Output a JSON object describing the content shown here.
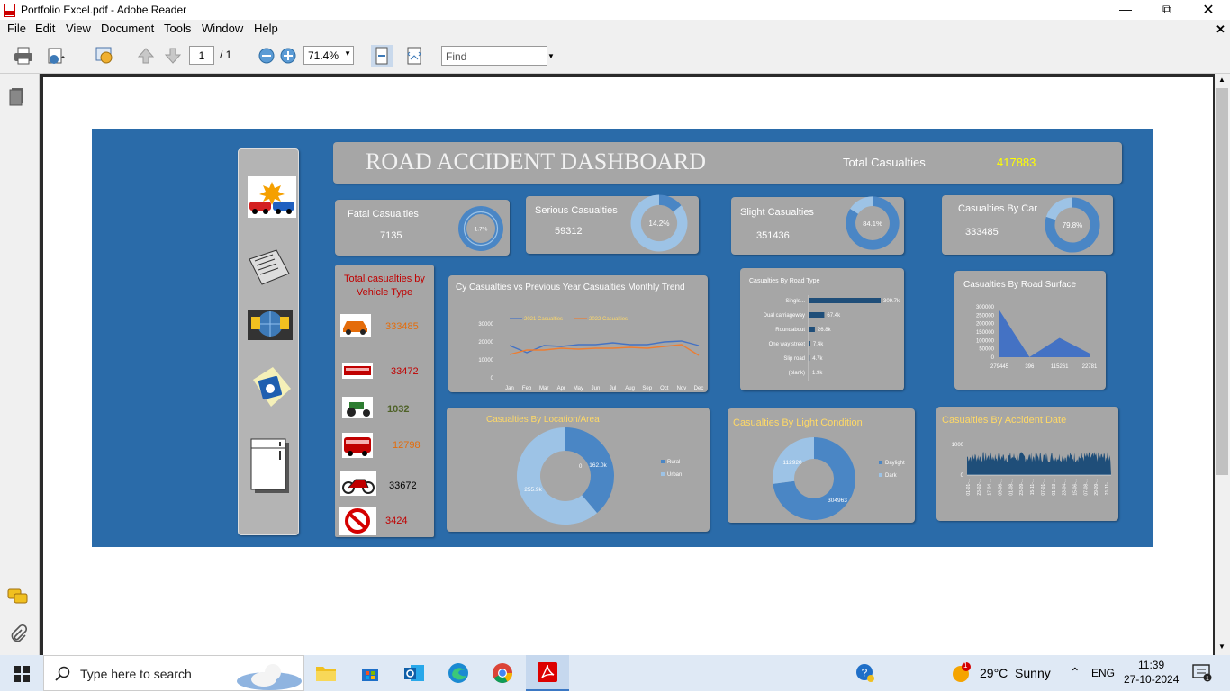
{
  "window": {
    "title": "Portfolio Excel.pdf - Adobe Reader"
  },
  "menu": [
    "File",
    "Edit",
    "View",
    "Document",
    "Tools",
    "Window",
    "Help"
  ],
  "toolbar": {
    "page_current": "1",
    "page_total": "/ 1",
    "zoom": "71.4%",
    "find_placeholder": "Find"
  },
  "dashboard": {
    "title": "ROAD ACCIDENT DASHBOARD",
    "total_label": "Total Casualties",
    "total_value": "417883",
    "kpis": [
      {
        "label": "Fatal Casualties",
        "value": "7135",
        "pct": "1.7%",
        "fraction": 0.017
      },
      {
        "label": "Serious Casualties",
        "value": "59312",
        "pct": "14.2%",
        "fraction": 0.142
      },
      {
        "label": "Slight Casualties",
        "value": "351436",
        "pct": "84.1%",
        "fraction": 0.841
      },
      {
        "label": "Casualties By Car",
        "value": "333485",
        "pct": "79.8%",
        "fraction": 0.798
      }
    ],
    "vehicle": {
      "title": "Total  casualties by Vehicle Type",
      "items": [
        {
          "icon": "car-icon",
          "value": "333485",
          "color": "#e46c0a"
        },
        {
          "icon": "bus-icon",
          "value": "33472",
          "color": "#c00000"
        },
        {
          "icon": "tractor-icon",
          "value": "1032",
          "color": "#4f6228"
        },
        {
          "icon": "van-icon",
          "value": "12798",
          "color": "#e46c0a"
        },
        {
          "icon": "motorcycle-icon",
          "value": "33672",
          "color": "#000000"
        },
        {
          "icon": "prohibited-icon",
          "value": "3424",
          "color": "#c00000"
        }
      ]
    },
    "nav_icons": [
      "car-crash-icon",
      "newspaper-icon",
      "globe-computer-icon",
      "disk-icon",
      "refrigerator-icon"
    ]
  },
  "chart_data": [
    {
      "type": "line",
      "title": "Cy Casualties vs Previous Year Casualties Monthly Trend",
      "categories": [
        "Jan",
        "Feb",
        "Mar",
        "Apr",
        "May",
        "Jun",
        "Jul",
        "Aug",
        "Sep",
        "Oct",
        "Nov",
        "Dec"
      ],
      "yticks": [
        "30000",
        "20000",
        "10000",
        "0"
      ],
      "ylim": [
        0,
        30000
      ],
      "series": [
        {
          "name": "2021 Casualties",
          "color": "#4472c4",
          "values": [
            18000,
            14000,
            18000,
            17500,
            18500,
            18500,
            19500,
            18500,
            18500,
            20000,
            20500,
            18000
          ]
        },
        {
          "name": "2022 Casualties",
          "color": "#ed7d31",
          "values": [
            13000,
            15500,
            15500,
            16500,
            16000,
            16500,
            16500,
            17000,
            16500,
            17500,
            18500,
            12500
          ]
        }
      ]
    },
    {
      "type": "bar",
      "title": "Casualties By Road Type",
      "categories": [
        "Single...",
        "Dual carriageway",
        "Roundabout",
        "One way street",
        "Slip road",
        "(blank)"
      ],
      "values": [
        309700,
        67400,
        26800,
        7400,
        4700,
        1900
      ],
      "labels": [
        "309.7k",
        "67.4k",
        "26.8k",
        "7.4k",
        "4.7k",
        "1.9k"
      ]
    },
    {
      "type": "area",
      "title": "Casualties By Road Surface",
      "categories": [
        "279445",
        "396",
        "115261",
        "22781"
      ],
      "values": [
        279445,
        396,
        115261,
        22781
      ],
      "yticks": [
        "300000",
        "250000",
        "200000",
        "150000",
        "100000",
        "50000",
        "0"
      ],
      "ylim": [
        0,
        300000
      ]
    },
    {
      "type": "pie",
      "title": "Casualties By Location/Area",
      "categories": [
        "Rural",
        "Urban"
      ],
      "values": [
        162000,
        255900
      ],
      "labels": [
        "162.0k",
        "255.9k"
      ],
      "inner_label": "0",
      "colors": [
        "#4a86c5",
        "#9dc3e6"
      ]
    },
    {
      "type": "pie",
      "title": "Casualties By Light Condition",
      "categories": [
        "Daylight",
        "Dark"
      ],
      "values": [
        304963,
        112920
      ],
      "labels": [
        "304963",
        "112920"
      ],
      "colors": [
        "#4a86c5",
        "#9dc3e6"
      ]
    },
    {
      "type": "area",
      "title": "Casualties By Accident Date",
      "yticks": [
        "1000",
        "0"
      ],
      "categories": [
        "01-01-...",
        "23-02-...",
        "17-04-...",
        "09-06-...",
        "01-08-...",
        "23-09-...",
        "15-11-...",
        "07-01-...",
        "01-03-...",
        "23-04-...",
        "15-06-...",
        "07-08-...",
        "29-09-...",
        "21-11-..."
      ]
    }
  ],
  "taskbar": {
    "search_placeholder": "Type here to search",
    "weather": "29°C  Sunny",
    "lang": "ENG",
    "time": "11:39",
    "date": "27-10-2024",
    "notif_count": "1"
  }
}
